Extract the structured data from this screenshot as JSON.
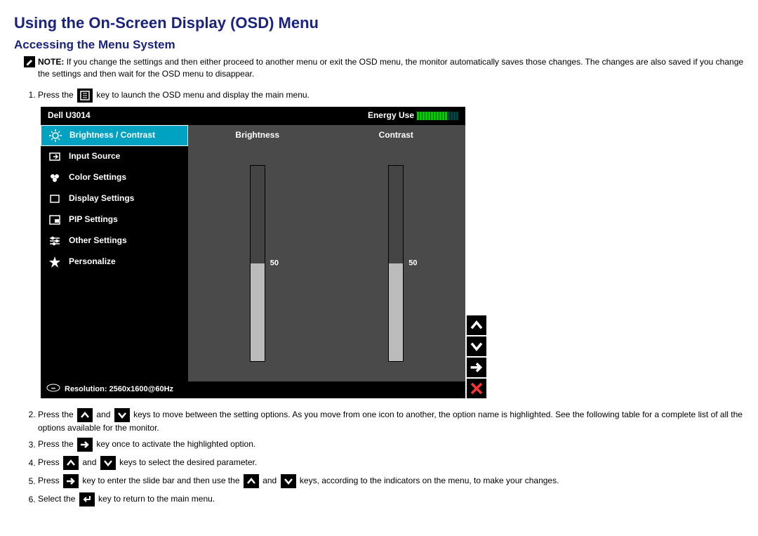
{
  "title": "Using the On-Screen Display (OSD) Menu",
  "subtitle": "Accessing the Menu System",
  "note": {
    "label": "NOTE:",
    "text": "If you change the settings and then either proceed to another menu or exit the OSD menu, the monitor automatically saves those changes. The changes are also saved if you change the settings and then wait for the OSD menu to disappear."
  },
  "steps": {
    "s1a": "Press the ",
    "s1b": " key to launch the OSD menu and display the main menu.",
    "s2a": "Press the ",
    "s2b": " and ",
    "s2c": " keys to move between the setting options. As you move from one icon to another, the option name is highlighted. See the following table for a complete list of all the options available for the monitor.",
    "s3a": "Press the ",
    "s3b": " key once to activate the highlighted option.",
    "s4a": "Press ",
    "s4b": " and ",
    "s4c": " keys to select the desired parameter.",
    "s5a": "Press ",
    "s5b": " key to enter the slide bar and then use the ",
    "s5c": " and ",
    "s5d": " keys, according to the indicators on the menu, to make your changes.",
    "s6a": "Select the ",
    "s6b": " key to return to the main menu."
  },
  "osd": {
    "model": "Dell U3014",
    "energy_label": "Energy Use",
    "nav": [
      "Brightness / Contrast",
      "Input Source",
      "Color Settings",
      "Display Settings",
      "PIP Settings",
      "Other Settings",
      "Personalize"
    ],
    "col1": "Brightness",
    "col2": "Contrast",
    "val1": "50",
    "val2": "50",
    "resolution": "Resolution: 2560x1600@60Hz"
  }
}
